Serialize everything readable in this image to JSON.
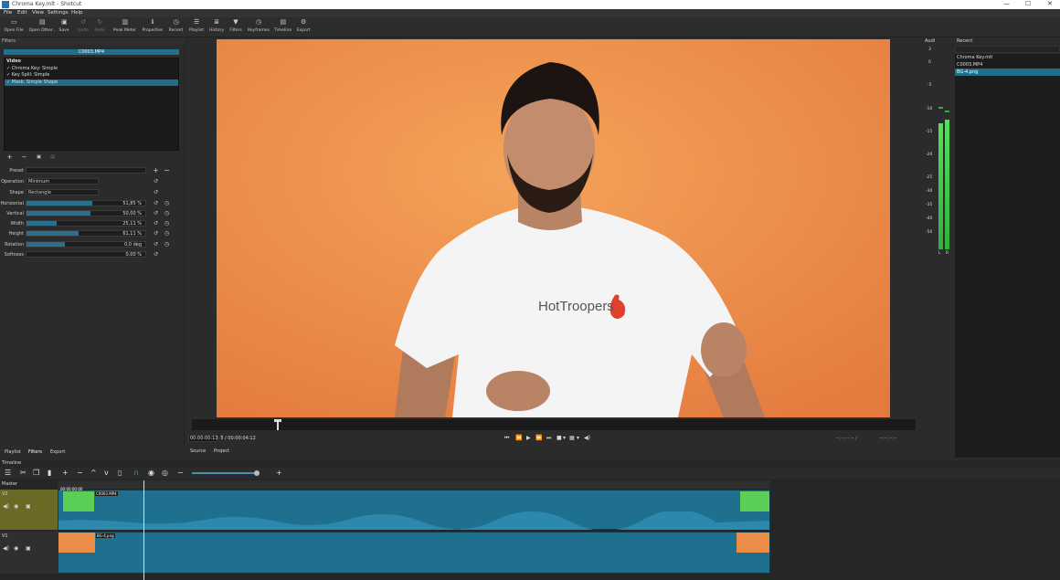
{
  "window": {
    "title": "Chroma Key.mlt - Shotcut",
    "controls": [
      "—",
      "☐",
      "✕"
    ]
  },
  "menu": [
    "File",
    "Edit",
    "View",
    "Settings",
    "Help"
  ],
  "toolbar": [
    {
      "label": "Open File",
      "icon": "open-file-icon",
      "glyph": "▭"
    },
    {
      "label": "Open Other..",
      "icon": "open-other-icon",
      "glyph": "▤"
    },
    {
      "label": "Save",
      "icon": "save-icon",
      "glyph": "▣"
    },
    {
      "label": "Undo",
      "icon": "undo-icon",
      "glyph": "↺"
    },
    {
      "label": "Redo",
      "icon": "redo-icon",
      "glyph": "↻"
    },
    {
      "label": "Peak Meter",
      "icon": "peak-meter-icon",
      "glyph": "▥"
    },
    {
      "label": "Properties",
      "icon": "properties-icon",
      "glyph": "ℹ"
    },
    {
      "label": "Recent",
      "icon": "recent-icon",
      "glyph": "◷"
    },
    {
      "label": "Playlist",
      "icon": "playlist-icon",
      "glyph": "☰"
    },
    {
      "label": "History",
      "icon": "history-icon",
      "glyph": "≣"
    },
    {
      "label": "Filters",
      "icon": "filters-icon",
      "glyph": "▼"
    },
    {
      "label": "Keyframes",
      "icon": "keyframes-icon",
      "glyph": "◷"
    },
    {
      "label": "Timeline",
      "icon": "timeline-icon",
      "glyph": "▤"
    },
    {
      "label": "Export",
      "icon": "export-icon",
      "glyph": "⚙"
    }
  ],
  "filters": {
    "header": "Filters",
    "clip_name": "C0003.MP4",
    "group": "Video",
    "items": [
      "✓ Chroma Key: Simple",
      "✓ Key Spill: Simple",
      "✓ Mask: Simple Shape"
    ],
    "selected_index": 2,
    "params": [
      {
        "label": "Preset",
        "kind": "combo",
        "value": ""
      },
      {
        "label": "Operation",
        "kind": "combo",
        "value": "Minimum"
      },
      {
        "label": "Shape",
        "kind": "combo",
        "value": "Rectangle"
      },
      {
        "label": "Horizontal",
        "kind": "slider",
        "value": "51,85 %",
        "fill": 0.55
      },
      {
        "label": "Vertical",
        "kind": "slider",
        "value": "50,00 %",
        "fill": 0.54
      },
      {
        "label": "Width",
        "kind": "slider",
        "value": "25,11 %",
        "fill": 0.25
      },
      {
        "label": "Height",
        "kind": "slider",
        "value": "61,11 %",
        "fill": 0.44
      },
      {
        "label": "Rotation",
        "kind": "slider",
        "value": "0,0 deg",
        "fill": 0.32
      },
      {
        "label": "Softness",
        "kind": "slider",
        "value": "0,00 %",
        "fill": 0.0
      }
    ]
  },
  "left_tabs": [
    "Playlist",
    "Filters",
    "Export"
  ],
  "viewer": {
    "shirt_text": "HotTroopers",
    "timecode": "00:00:00:13",
    "duration": "/ 00:00:04:12",
    "zoom_left": "--:--:--:-- /",
    "zoom_right": "--:--:--:--",
    "tabs": [
      "Source",
      "Project"
    ]
  },
  "audio": {
    "header": "Audi",
    "scale": [
      "3",
      "0",
      "-5",
      "-10",
      "-15",
      "-20",
      "-25",
      "-30",
      "-35",
      "-40",
      "-50"
    ],
    "channels": [
      "L",
      "R"
    ]
  },
  "recent": {
    "header": "Recent",
    "items": [
      "Chroma Key.mlt",
      "C0003.MP4",
      "BG-4.png"
    ],
    "selected_index": 2
  },
  "timeline": {
    "header": "Timeline",
    "master": "Master",
    "tracks": [
      {
        "name": "V2",
        "clip_start": "00:00:00:00",
        "clip_label": "C0003.MP4"
      },
      {
        "name": "V1",
        "clip_label": "BG-4.png"
      }
    ]
  },
  "colors": {
    "accent": "#1e6e8c",
    "background": "#eb8c47",
    "track_header": "#6a6a26",
    "clip": "#1f6f8f"
  }
}
